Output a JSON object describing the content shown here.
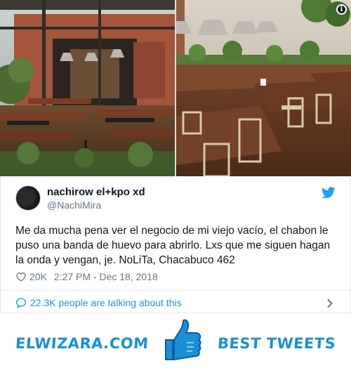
{
  "photos": [
    {
      "alt_icon": "restaurant-photo-terrace"
    },
    {
      "alt_icon": "restaurant-photo-interior"
    }
  ],
  "tweet": {
    "author_name": "nachirow el+kpo xd",
    "author_handle": "@NachiMira",
    "text": "Me da mucha pena ver el negocio de mi viejo vacío, el chabon le puso una banda de huevo para abrirlo. Lxs que me siguen hagan la onda y vengan, je. NoLiTa, Chacabuco 462",
    "likes": "20K",
    "timestamp": "2:27 PM - Dec 18, 2018",
    "talking": "22.3K people are talking about this"
  },
  "banner": {
    "left_text": "ELWIZARA.COM",
    "right_text": "BEST TWEETS"
  },
  "colors": {
    "accent": "#1b95e0",
    "brand": "#1a90d9",
    "text": "#14171a",
    "muted": "#657786"
  },
  "icons": [
    "info-icon",
    "twitter-bird-icon",
    "heart-icon",
    "speech-bubble-icon",
    "chevron-right-icon",
    "thumbs-up-icon"
  ]
}
